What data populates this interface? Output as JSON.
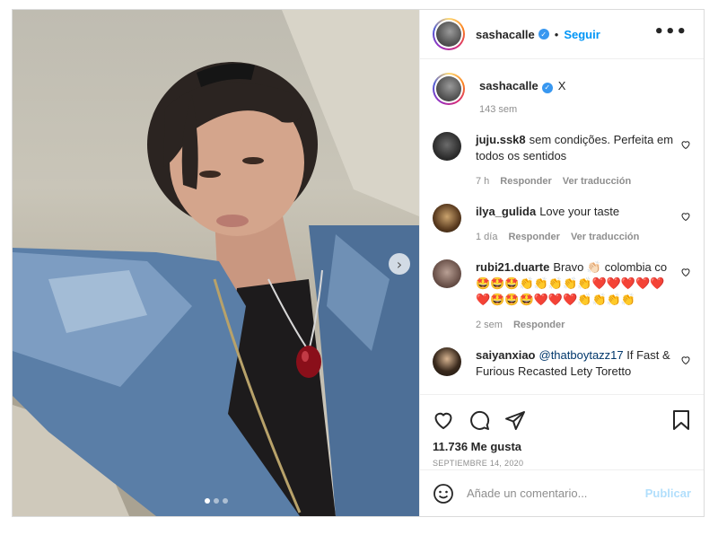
{
  "post": {
    "author": "sashacalle",
    "follow_label": "Seguir",
    "separator": "•",
    "more_label": "•••",
    "caption_text": "X",
    "caption_time": "143 sem",
    "carousel_total": 3,
    "carousel_active": 1
  },
  "comments": [
    {
      "user": "juju.ssk8",
      "text": "sem condições. Perfeita em todos os sentidos",
      "time": "7 h",
      "reply": "Responder",
      "translate": "Ver traducción"
    },
    {
      "user": "ilya_gulida",
      "text": "Love your taste",
      "time": "1 día",
      "reply": "Responder",
      "translate": "Ver traducción"
    },
    {
      "user": "rubi21.duarte",
      "text": "Bravo 👏🏻 colombia co 🤩🤩🤩👏👏👏👏👏❤️❤️❤️❤️❤️❤️🤩🤩🤩❤️❤️❤️👏👏👏👏",
      "time": "2 sem",
      "reply": "Responder"
    },
    {
      "user": "saiyanxiao",
      "mention": "@thatboytazz17",
      "text": "If Fast & Furious Recasted Lety Toretto"
    }
  ],
  "stats": {
    "likes": "11.736 Me gusta",
    "date": "SEPTIEMBRE 14, 2020"
  },
  "composer": {
    "placeholder": "Añade un comentario...",
    "publish_label": "Publicar"
  },
  "colors": {
    "link_blue": "#0095f6",
    "verified_blue": "#3897f0",
    "muted_text": "#8e8e8e"
  },
  "icons": [
    "verified-badge-icon",
    "more-options-icon",
    "heart-icon",
    "comment-icon",
    "share-icon",
    "bookmark-icon",
    "emoji-icon",
    "next-arrow-icon"
  ]
}
